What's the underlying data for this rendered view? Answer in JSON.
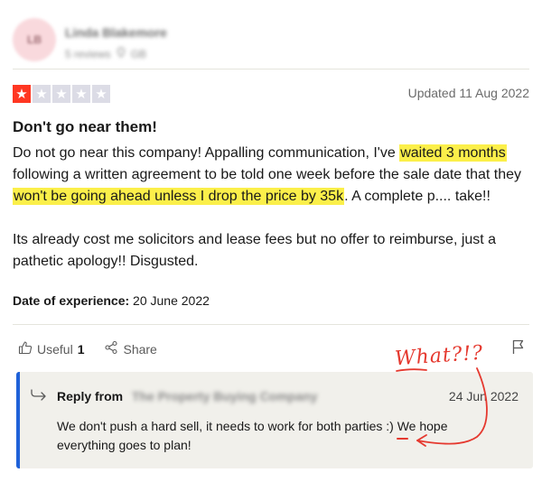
{
  "reviewer": {
    "initials": "LB",
    "name": "Linda Blakemore",
    "review_count": "5 reviews",
    "country": "GB"
  },
  "review": {
    "rating": 1,
    "rating_max": 5,
    "updated": "Updated 11 Aug 2022",
    "title": "Don't go near them!",
    "body_p1_a": "Do not go near this company! Appalling communication, I've ",
    "body_p1_hl1": "waited 3 months",
    "body_p1_b": " following a written agreement to be told one week before the sale date that they ",
    "body_p1_hl2": "won't be going ahead unless I drop the price by 35k",
    "body_p1_c": ". A complete p.... take!!",
    "body_p2": "Its already cost me solicitors and lease fees but no offer to reimburse, just a pathetic apology!! Disgusted.",
    "experience_label": "Date of experience:",
    "experience_date": " 20 June 2022"
  },
  "actions": {
    "useful_label": "Useful",
    "useful_count": "1",
    "share_label": "Share"
  },
  "reply": {
    "from_label": "Reply from",
    "company": "The Property Buying Company",
    "date": "24 Jun 2022",
    "text": "We don't push a hard sell, it needs to work for both parties :) We hope everything goes to plan!"
  },
  "annotation": {
    "text": "What?!?",
    "color": "#e5392f"
  },
  "colors": {
    "star_filled": "#ff3722",
    "star_empty": "#dcdce6",
    "highlight": "#fbef4a",
    "reply_accent": "#1f61d8",
    "reply_bg": "#f1f0eb"
  }
}
